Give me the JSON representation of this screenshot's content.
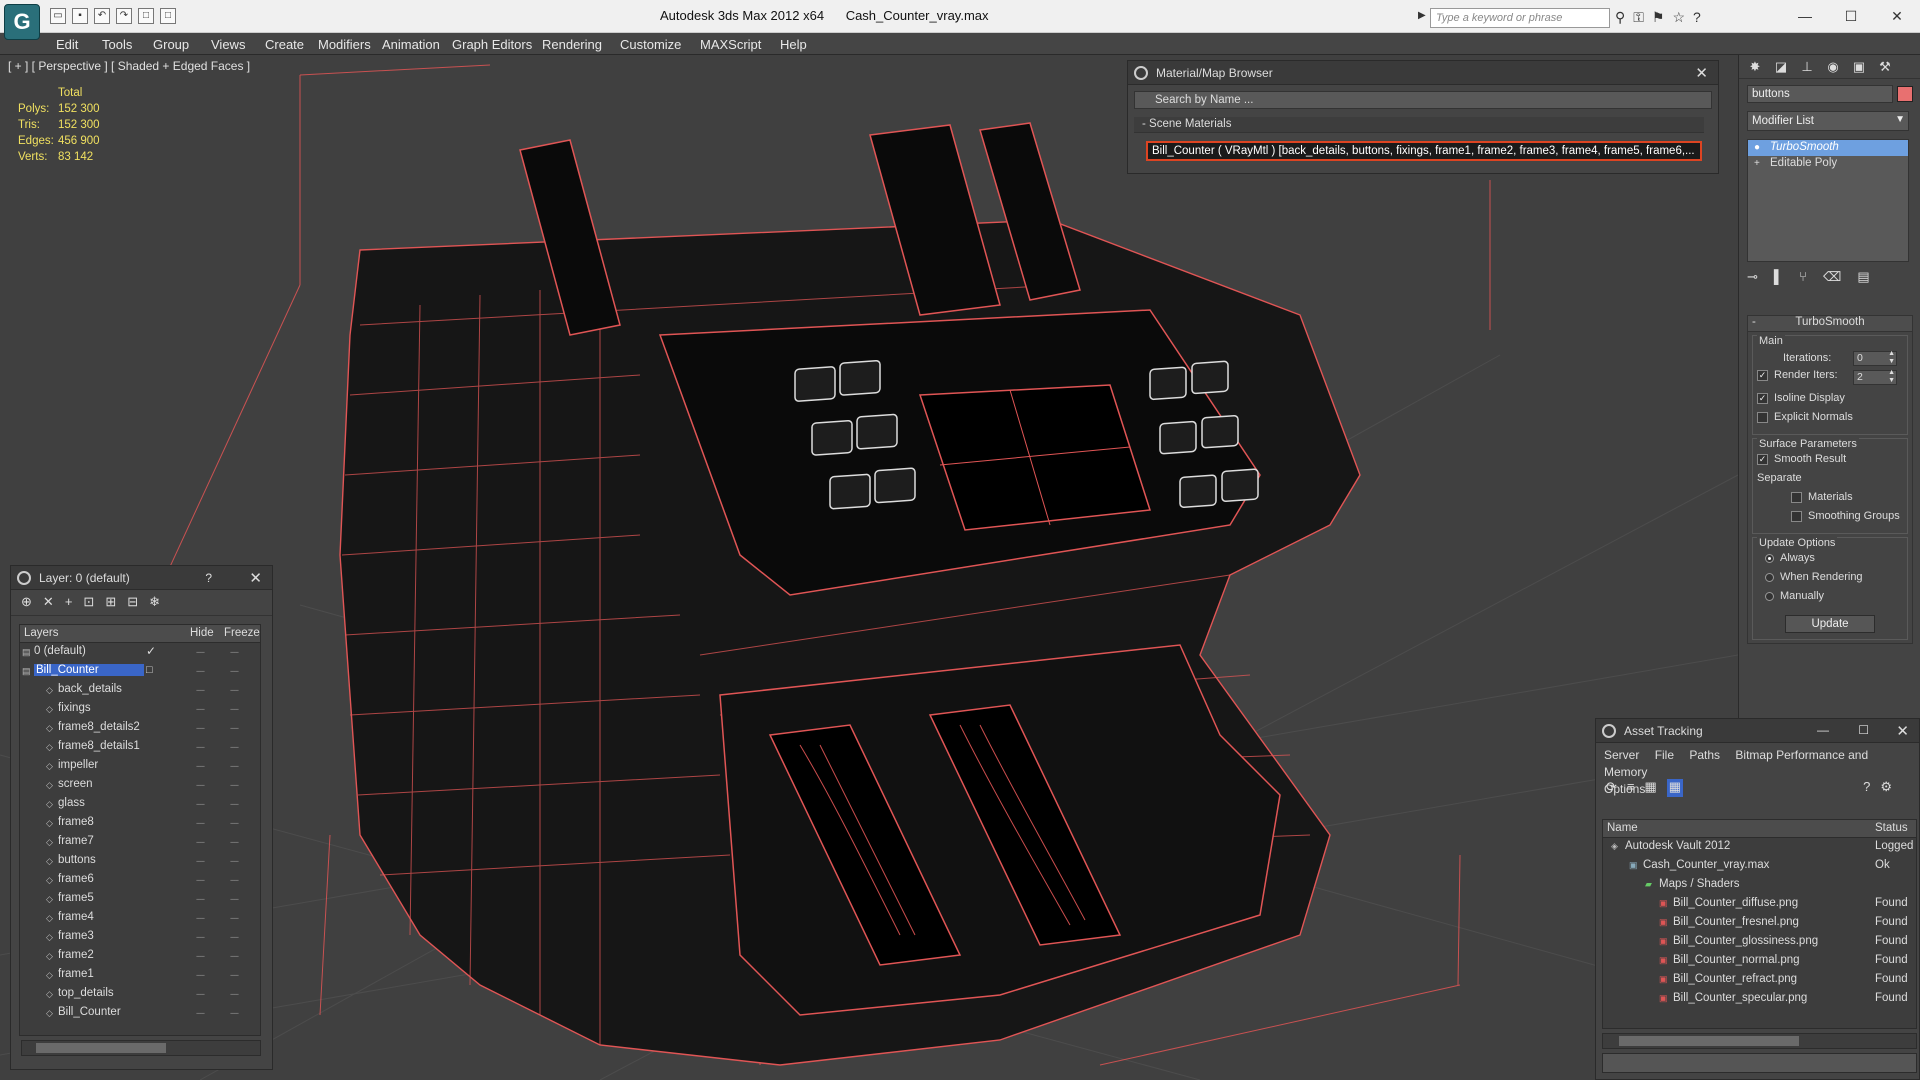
{
  "titlebar": {
    "app_title": "Autodesk 3ds Max  2012 x64",
    "file_name": "Cash_Counter_vray.max",
    "search_placeholder": "Type a keyword or phrase",
    "logo_glyph": "G"
  },
  "menubar": {
    "items": [
      "Edit",
      "Tools",
      "Group",
      "Views",
      "Create",
      "Modifiers",
      "Animation",
      "Graph Editors",
      "Rendering",
      "Customize",
      "MAXScript",
      "Help"
    ]
  },
  "viewport": {
    "label": "[ + ] [ Perspective ] [ Shaded + Edged Faces ]",
    "stats": {
      "header": "Total",
      "rows": [
        {
          "key": "Polys:",
          "value": "152 300"
        },
        {
          "key": "Tris:",
          "value": "152 300"
        },
        {
          "key": "Edges:",
          "value": "456 900"
        },
        {
          "key": "Verts:",
          "value": "83 142"
        }
      ]
    },
    "wire_color": "#e05555"
  },
  "material_browser": {
    "title": "Material/Map Browser",
    "search": "Search by Name ...",
    "section": "- Scene Materials",
    "item": "Bill_Counter  ( VRayMtl )  [back_details, buttons, fixings, frame1, frame2, frame3, frame4, frame5, frame6,..."
  },
  "command_panel": {
    "object_name": "buttons",
    "object_color": "#e87070",
    "modifier_list": "Modifier List",
    "stack": [
      "TurboSmooth",
      "Editable Poly"
    ],
    "turbosmooth": {
      "title": "TurboSmooth",
      "main_label": "Main",
      "iterations_label": "Iterations:",
      "iterations": "0",
      "render_iters_label": "Render Iters:",
      "render_iters": "2",
      "isoline": "Isoline Display",
      "explicit": "Explicit Normals",
      "surface_label": "Surface Parameters",
      "smooth_result": "Smooth Result",
      "separate_label": "Separate",
      "materials": "Materials",
      "smoothing_groups": "Smoothing Groups",
      "update_label": "Update Options",
      "always": "Always",
      "when_rendering": "When Rendering",
      "manually": "Manually",
      "update_button": "Update"
    }
  },
  "layers": {
    "title": "Layer: 0 (default)",
    "help": "?",
    "columns": [
      "Layers",
      "Hide",
      "Freeze"
    ],
    "rows": [
      "0 (default)",
      "Bill_Counter",
      "back_details",
      "fixings",
      "frame8_details2",
      "frame8_details1",
      "impeller",
      "screen",
      "glass",
      "frame8",
      "frame7",
      "buttons",
      "frame6",
      "frame5",
      "frame4",
      "frame3",
      "frame2",
      "frame1",
      "top_details",
      "Bill_Counter"
    ]
  },
  "asset_tracking": {
    "title": "Asset Tracking",
    "menu": [
      "Server",
      "File",
      "Paths",
      "Bitmap Performance and Memory",
      "Options"
    ],
    "columns": [
      "Name",
      "Status"
    ],
    "rows": [
      {
        "name": "Autodesk Vault 2012",
        "status": "Logged O"
      },
      {
        "name": "Cash_Counter_vray.max",
        "status": "Ok"
      },
      {
        "name": "Maps / Shaders",
        "status": ""
      },
      {
        "name": "Bill_Counter_diffuse.png",
        "status": "Found"
      },
      {
        "name": "Bill_Counter_fresnel.png",
        "status": "Found"
      },
      {
        "name": "Bill_Counter_glossiness.png",
        "status": "Found"
      },
      {
        "name": "Bill_Counter_normal.png",
        "status": "Found"
      },
      {
        "name": "Bill_Counter_refract.png",
        "status": "Found"
      },
      {
        "name": "Bill_Counter_specular.png",
        "status": "Found"
      }
    ]
  }
}
